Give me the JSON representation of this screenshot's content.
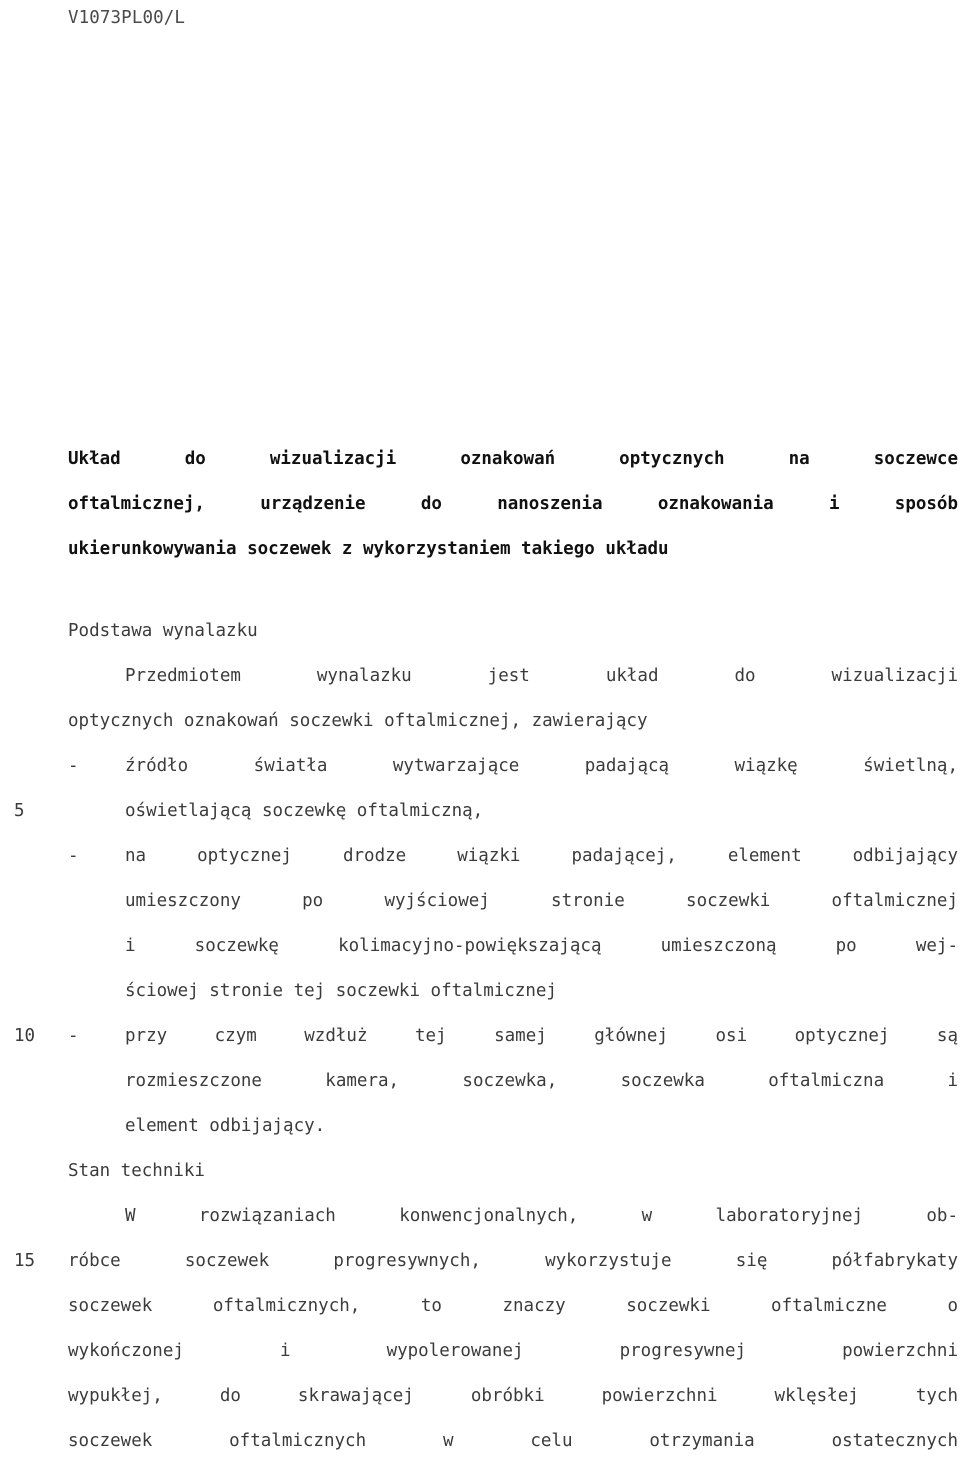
{
  "header": {
    "doc_code": "V1073PL00/L"
  },
  "title": {
    "lines": [
      "Układ do wizualizacji oznakowań optycznych na soczewce",
      "oftalmicznej, urządzenie do nanoszenia oznakowania i sposób",
      "ukierunkowywania soczewek z wykorzystaniem takiego układu"
    ]
  },
  "body": {
    "lines": [
      {
        "number": "",
        "dash": "",
        "indent": false,
        "justify": false,
        "text": "Podstawa wynalazku"
      },
      {
        "number": "",
        "dash": "",
        "indent": true,
        "justify": true,
        "text": "Przedmiotem wynalazku jest układ do wizualizacji"
      },
      {
        "number": "",
        "dash": "",
        "indent": false,
        "justify": false,
        "text": "optycznych oznakowań soczewki oftalmicznej, zawierający"
      },
      {
        "number": "",
        "dash": "-",
        "indent": true,
        "justify": true,
        "text": "źródło światła wytwarzające padającą wiązkę świetlną,"
      },
      {
        "number": "5",
        "dash": "",
        "indent": true,
        "justify": false,
        "text": "oświetlającą soczewkę oftalmiczną,"
      },
      {
        "number": "",
        "dash": "-",
        "indent": true,
        "justify": true,
        "text": "na optycznej drodze wiązki padającej, element odbijający"
      },
      {
        "number": "",
        "dash": "",
        "indent": true,
        "justify": true,
        "text": "umieszczony po wyjściowej stronie soczewki oftalmicznej"
      },
      {
        "number": "",
        "dash": "",
        "indent": true,
        "justify": true,
        "text": "i soczewkę kolimacyjno-powiększającą umieszczoną po wej-"
      },
      {
        "number": "",
        "dash": "",
        "indent": true,
        "justify": false,
        "text": "ściowej stronie tej soczewki oftalmicznej"
      },
      {
        "number": "10",
        "dash": "-",
        "indent": true,
        "justify": true,
        "text": "przy czym wzdłuż tej samej głównej osi optycznej są"
      },
      {
        "number": "",
        "dash": "",
        "indent": true,
        "justify": true,
        "text": "rozmieszczone kamera, soczewka, soczewka oftalmiczna i"
      },
      {
        "number": "",
        "dash": "",
        "indent": true,
        "justify": false,
        "text": "element odbijający."
      },
      {
        "number": "",
        "dash": "",
        "indent": false,
        "justify": false,
        "text": "Stan techniki"
      },
      {
        "number": "",
        "dash": "",
        "indent": true,
        "justify": true,
        "text": "W rozwiązaniach konwencjonalnych, w laboratoryjnej ob-"
      },
      {
        "number": "15",
        "dash": "",
        "indent": false,
        "justify": true,
        "text": "róbce soczewek progresywnych, wykorzystuje się półfabrykaty"
      },
      {
        "number": "",
        "dash": "",
        "indent": false,
        "justify": true,
        "text": "soczewek oftalmicznych, to znaczy soczewki oftalmiczne o"
      },
      {
        "number": "",
        "dash": "",
        "indent": false,
        "justify": true,
        "text": "wykończonej i wypolerowanej progresywnej powierzchni"
      },
      {
        "number": "",
        "dash": "",
        "indent": false,
        "justify": true,
        "text": "wypukłej, do skrawającej obróbki powierzchni wklęsłej tych"
      },
      {
        "number": "",
        "dash": "",
        "indent": false,
        "justify": true,
        "text": "soczewek oftalmicznych w celu otrzymania ostatecznych"
      }
    ]
  }
}
